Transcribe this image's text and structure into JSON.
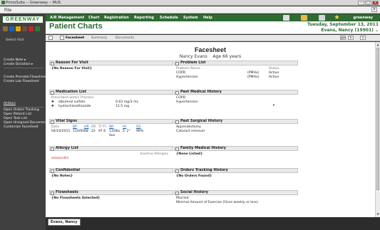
{
  "window": {
    "title": "PrimeSuite -- Greenway -- MUS"
  },
  "menubar": {
    "file": "File",
    "close": "x"
  },
  "logo": {
    "text": "GREENWAY"
  },
  "colors": {
    "brand_green": "#2f6b32",
    "sidebar": "#404040",
    "allergy_red": "#c62828"
  },
  "sidebar": {
    "select_visit": "Select Visit",
    "notes_items": [
      "Create Note",
      "Create Dictation"
    ],
    "create_items": [
      "Create Prenatal Flowsheet",
      "Create Lab Flowsheet"
    ],
    "actions_label": "Actions",
    "action_items": [
      "Open Orders Tracking",
      "Open Patient List",
      "Open Task List",
      "Open Unsigned Documents",
      "Customize Facesheet"
    ]
  },
  "nav": {
    "items": [
      "A/R Management",
      "Chart",
      "Registration",
      "Reporting",
      "Schedule",
      "System",
      "Help"
    ],
    "user": "greenway"
  },
  "header": {
    "page_title": "Patient Charts",
    "date": "Tuesday, September 13, 2011",
    "patient": "Evans, Nancy (19901)"
  },
  "tabs": {
    "facesheet": "Facesheet",
    "summary": "Summary",
    "documents": "Documents"
  },
  "facesheet": {
    "title": "Facesheet",
    "name": "Nancy Evans",
    "age": "Age 66 years"
  },
  "panels": {
    "reason": {
      "title": "Reason For Visit",
      "body": "{No Reason For Visit}"
    },
    "problem": {
      "title": "Problem List",
      "col1": "Problem Name",
      "col2": "Status",
      "rows": [
        {
          "name": "COPD",
          "type": "(PMHx)",
          "status": "Active"
        },
        {
          "name": "Hypertension",
          "type": "(PMHx)",
          "status": "Active"
        }
      ]
    },
    "medication": {
      "title": "Medication List",
      "sub": "Prescribed within Practice",
      "rows": [
        {
          "name": "albuterol sulfate",
          "dose": "0.63 mg/3 mL"
        },
        {
          "name": "hydrochlorothiazide",
          "dose": "12.5 mg"
        }
      ]
    },
    "pmh": {
      "title": "Past Medical History",
      "items": [
        "COPD",
        "Hypertension"
      ]
    },
    "vitals": {
      "title": "Vital Signs",
      "headers": [
        "Date",
        "BP",
        "HR",
        "RR",
        "T(°F)",
        "Wt",
        "Ht",
        "O2"
      ],
      "row": [
        "04/10/2011",
        "110/65",
        "68",
        "22",
        "97.6",
        "135lbs 0oz",
        "5' 2\"",
        "99%"
      ]
    },
    "psh": {
      "title": "Past Surgical History",
      "items": [
        "Appendectomy",
        "Cataract removal"
      ]
    },
    "allergy": {
      "title": "Allergy List",
      "inactive": "Inactive Allergies",
      "item": "amoxicillin"
    },
    "family": {
      "title": "Family Medical History",
      "body": "{None Listed}"
    },
    "confidential": {
      "title": "Confidential",
      "body": "{No Notes}"
    },
    "orders": {
      "title": "Orders Tracking History",
      "body": "{No Orders Found}"
    },
    "flowsheets": {
      "title": "Flowsheets",
      "body": "{No Flowsheets Selected}"
    },
    "social": {
      "title": "Social History",
      "items": [
        "Married",
        "Minimal Amount of Exercise (Once weekly or less)"
      ]
    }
  },
  "statusbar": {
    "patient_tab": "Evans, Nancy"
  }
}
